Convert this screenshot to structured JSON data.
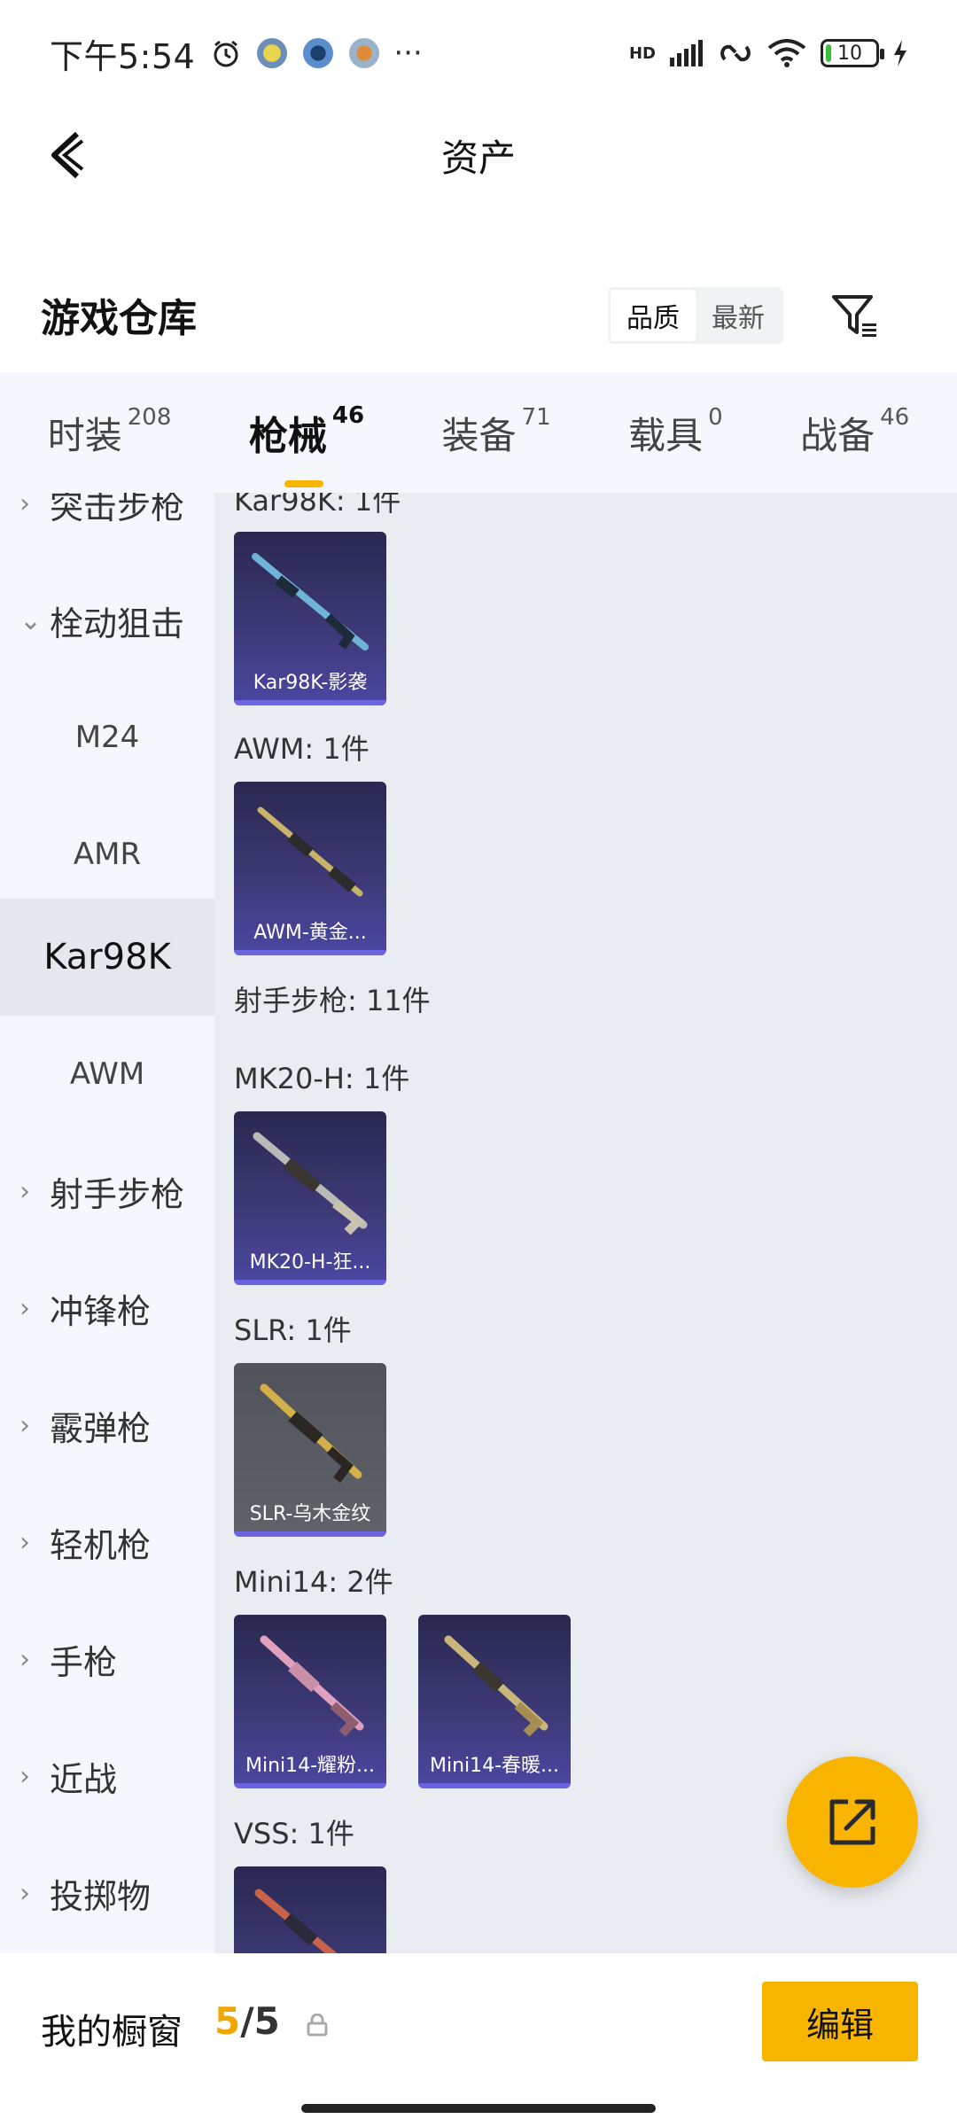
{
  "status_bar": {
    "time": "下午5:54",
    "dots": "···",
    "network": "HD",
    "battery": "10"
  },
  "header": {
    "title": "资产"
  },
  "warehouse": {
    "title": "游戏仓库",
    "sort_options": [
      "品质",
      "最新"
    ],
    "active_sort": "品质"
  },
  "tabs": [
    {
      "label": "时装",
      "count": "208"
    },
    {
      "label": "枪械",
      "count": "46"
    },
    {
      "label": "装备",
      "count": "71"
    },
    {
      "label": "载具",
      "count": "0"
    },
    {
      "label": "战备",
      "count": "46"
    }
  ],
  "active_tab": "枪械",
  "sidebar": {
    "items": [
      {
        "label": "突击步枪",
        "type": "category"
      },
      {
        "label": "栓动狙击",
        "type": "category-open"
      },
      {
        "label": "M24",
        "type": "sub"
      },
      {
        "label": "AMR",
        "type": "sub"
      },
      {
        "label": "Kar98K",
        "type": "sub-active"
      },
      {
        "label": "AWM",
        "type": "sub"
      },
      {
        "label": "射手步枪",
        "type": "category"
      },
      {
        "label": "冲锋枪",
        "type": "category"
      },
      {
        "label": "霰弹枪",
        "type": "category"
      },
      {
        "label": "轻机枪",
        "type": "category"
      },
      {
        "label": "手枪",
        "type": "category"
      },
      {
        "label": "近战",
        "type": "category"
      },
      {
        "label": "投掷物",
        "type": "category"
      }
    ]
  },
  "content": {
    "groups": [
      {
        "label": "Kar98K: 1件"
      },
      {
        "label": "AWM: 1件"
      },
      {
        "label": "射手步枪: 11件"
      },
      {
        "label": "MK20-H: 1件"
      },
      {
        "label": "SLR: 1件"
      },
      {
        "label": "Mini14: 2件"
      },
      {
        "label": "VSS: 1件"
      }
    ],
    "cards": [
      {
        "label": "Kar98K-影袭",
        "style": "purple"
      },
      {
        "label": "AWM-黄金...",
        "style": "purple"
      },
      {
        "label": "MK20-H-狂...",
        "style": "purple"
      },
      {
        "label": "SLR-乌木金纹",
        "style": "grey"
      },
      {
        "label": "Mini14-耀粉...",
        "style": "purple"
      },
      {
        "label": "Mini14-春暖...",
        "style": "purple"
      },
      {
        "label": "",
        "style": "purple"
      }
    ]
  },
  "bottom": {
    "label": "我的橱窗",
    "current": "5",
    "separator": "/",
    "max": "5",
    "edit_label": "编辑"
  },
  "colors": {
    "accent": "#f7b500",
    "card_purple": "#3e3a78",
    "card_border": "#6b63e0",
    "sidebar_bg": "#f4f7fb",
    "content_bg": "#e9ecf1"
  }
}
